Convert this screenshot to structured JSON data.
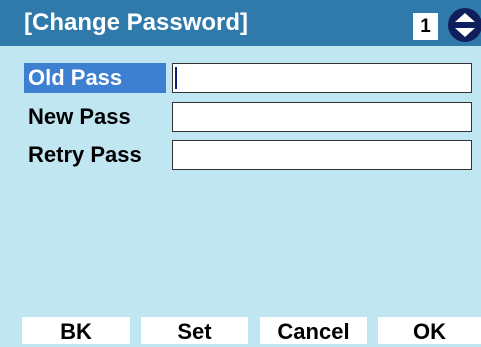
{
  "header": {
    "title": "[Change Password]",
    "page_indicator": "1",
    "scroll_icon": "up-down-arrows-icon"
  },
  "form": {
    "fields": [
      {
        "label": "Old Pass",
        "value": "",
        "selected": true
      },
      {
        "label": "New Pass",
        "value": "",
        "selected": false
      },
      {
        "label": "Retry Pass",
        "value": "",
        "selected": false
      }
    ]
  },
  "softkeys": [
    "BK",
    "Set",
    "Cancel",
    "OK"
  ],
  "colors": {
    "title_bar": "#2f79ab",
    "background": "#c0e6f2",
    "selected_label": "#3d7fd0"
  }
}
